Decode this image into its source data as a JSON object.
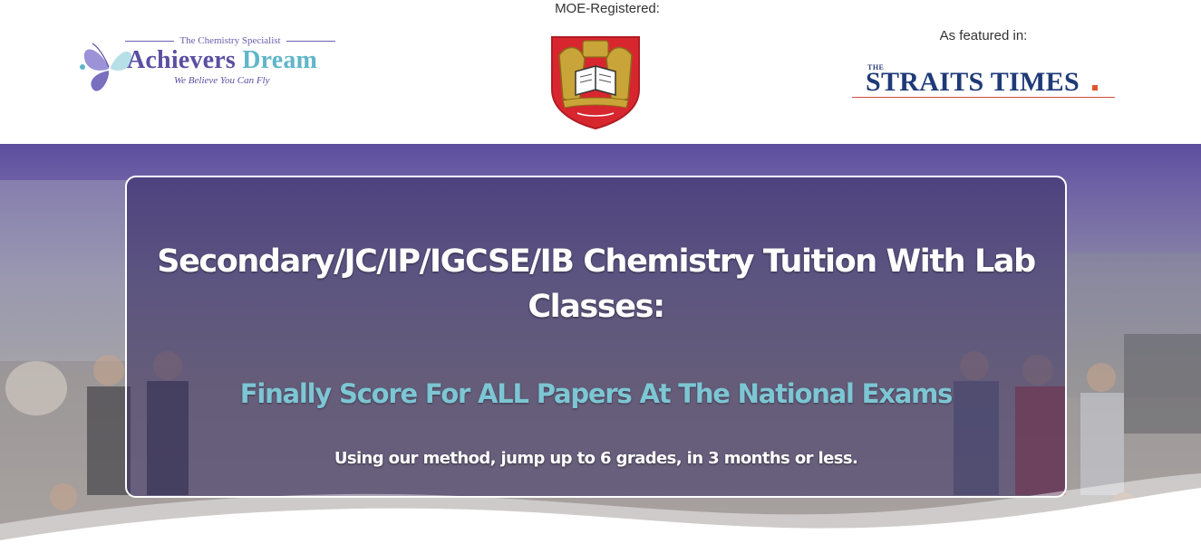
{
  "header": {
    "logo": {
      "tagline": "The Chemistry Specialist",
      "name_part1": "Achievers",
      "name_part2": "Dream",
      "slogan": "We Believe You Can Fly"
    },
    "moe_label": "MOE-Registered:",
    "moe_crest_icon": "ministry-of-education-crest-icon",
    "featured_label": "As featured in:",
    "featured_logo": {
      "small": "THE",
      "name": "STRAITS TIMES"
    }
  },
  "hero": {
    "title": "Secondary/JC/IP/IGCSE/IB Chemistry Tuition With Lab Classes:",
    "subtitle": "Finally Score For ALL Papers At The National Exams",
    "tagline": "Using our method, jump up to 6 grades, in 3 months or less."
  },
  "colors": {
    "brand_purple": "#5b4fa3",
    "brand_teal": "#5fb6c8",
    "hero_overlay": "#362c60",
    "subtitle_teal": "#7dc6d4",
    "straits_blue": "#1f3a78",
    "straits_orange": "#e0542b"
  }
}
